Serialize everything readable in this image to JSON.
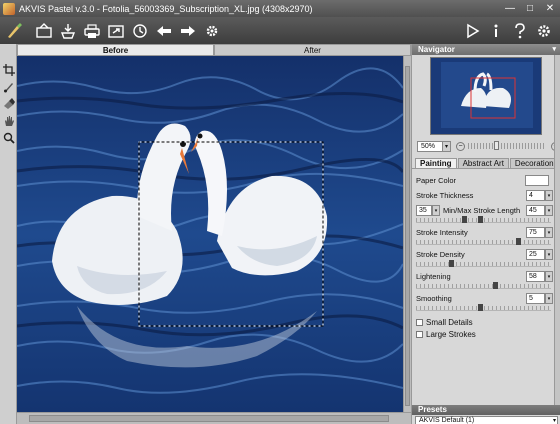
{
  "window": {
    "title": "AKVIS Pastel v.3.0 - Fotolia_56003369_Subscription_XL.jpg (4308x2970)",
    "controls": [
      "minimize",
      "maximize",
      "close"
    ]
  },
  "toolbar": {
    "left_icons": [
      "open-icon",
      "save-icon",
      "print-icon",
      "share-icon",
      "batch-icon",
      "undo-icon",
      "redo-icon",
      "settings-icon"
    ],
    "right_icons": [
      "run-icon",
      "info-icon",
      "help-icon",
      "preferences-icon"
    ]
  },
  "tools": [
    "crop-tool",
    "brush-tool",
    "eraser-tool",
    "hand-tool",
    "zoom-tool"
  ],
  "view_tabs": {
    "before": "Before",
    "after": "After"
  },
  "navigator": {
    "title": "Navigator",
    "zoom": "50%",
    "zoom_level": 0.5
  },
  "panel_tabs": {
    "painting": "Painting",
    "abstract_art": "Abstract Art",
    "decoration": "Decoration"
  },
  "settings": {
    "paper_color_label": "Paper Color",
    "paper_color": "#ffffff",
    "stroke_thickness_label": "Stroke Thickness",
    "stroke_thickness": "4",
    "minmax_label": "Min/Max Stroke Length",
    "min_stroke": "35",
    "max_stroke": "45",
    "stroke_intensity_label": "Stroke Intensity",
    "stroke_intensity": "75",
    "stroke_density_label": "Stroke Density",
    "stroke_density": "25",
    "lightening_label": "Lightening",
    "lightening": "58",
    "smoothing_label": "Smoothing",
    "smoothing": "5",
    "small_details_label": "Small Details",
    "large_strokes_label": "Large Strokes"
  },
  "presets": {
    "title": "Presets",
    "selected": "AKVIS Default (1)"
  },
  "colors": {
    "title_bar": "#5c5c5c",
    "toolbar": "#4a4a4a",
    "panel": "#d8d8d8",
    "water": "#1c3f7a"
  }
}
